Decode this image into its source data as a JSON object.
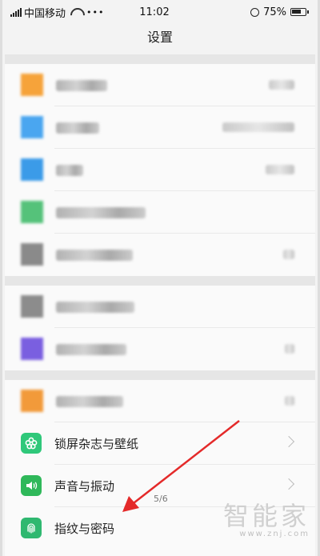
{
  "status_bar": {
    "carrier": "中国移动",
    "time": "11:02",
    "battery": "75%",
    "battery_level": 0.75
  },
  "header": {
    "title": "设置"
  },
  "settings": [
    {
      "label": "锁屏杂志与壁纸",
      "icon": "flower-icon",
      "color": "#2fc87a"
    },
    {
      "label": "声音与振动",
      "icon": "speaker-icon",
      "color": "#2fb85a"
    },
    {
      "label": "指纹与密码",
      "icon": "fingerprint-icon",
      "color": "#2fb870"
    }
  ],
  "page_indicator": "5/6",
  "watermark": {
    "main": "智能家",
    "sub": "www.znj.com"
  },
  "colors": {
    "arrow": "#e42a2a",
    "chevron": "#bdbdbd"
  }
}
